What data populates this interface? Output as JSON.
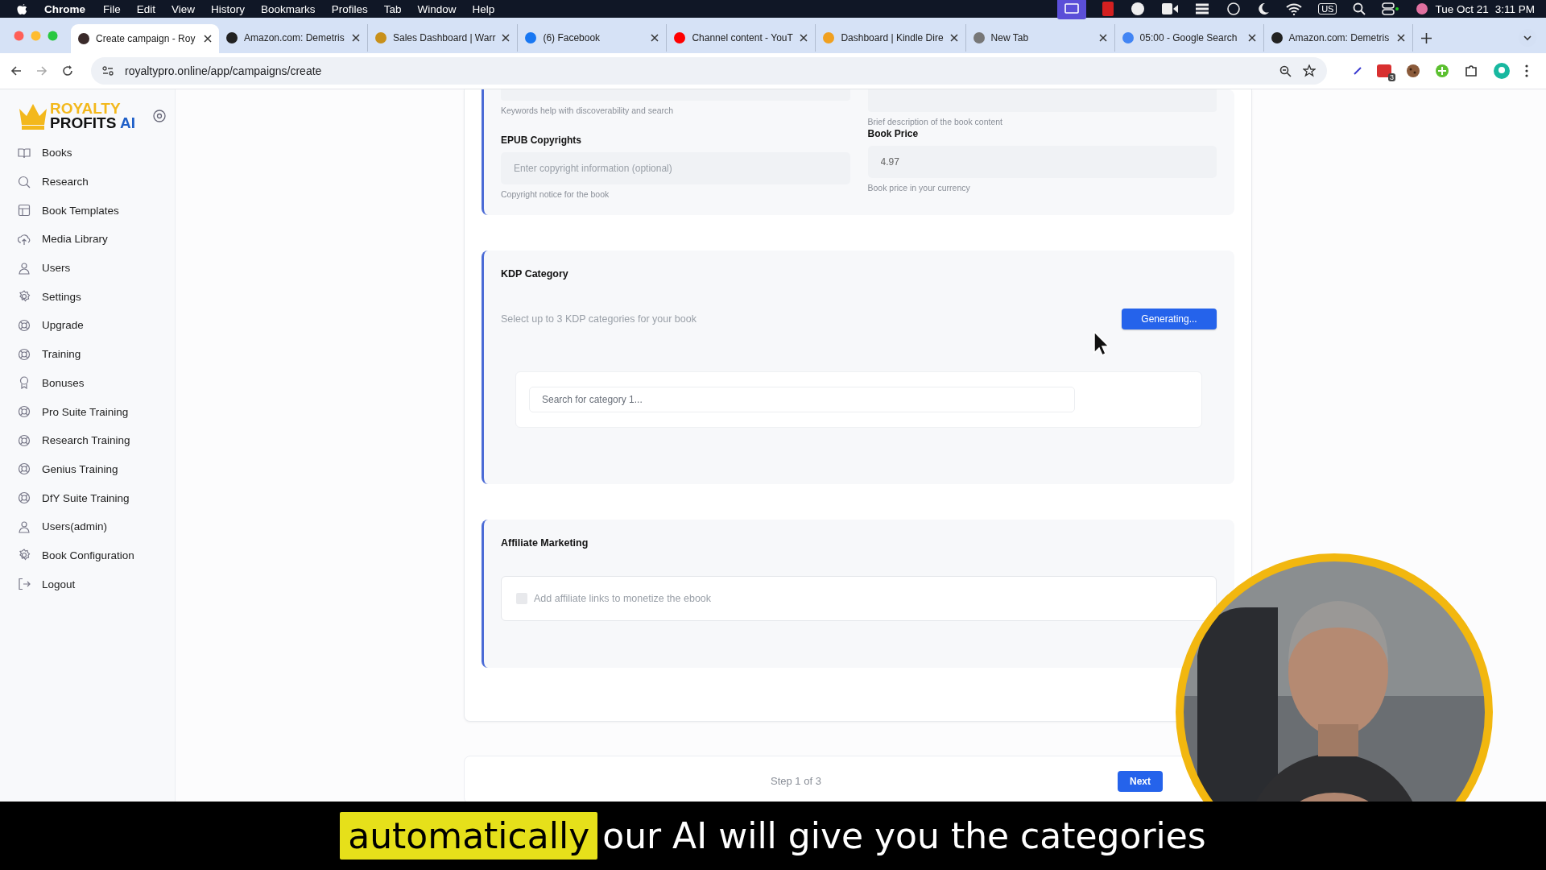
{
  "menu_bar": {
    "app": "Chrome",
    "items": [
      "File",
      "Edit",
      "View",
      "History",
      "Bookmarks",
      "Profiles",
      "Tab",
      "Window",
      "Help"
    ],
    "input_source": "US",
    "date": "Tue Oct 21",
    "time": "3:11 PM"
  },
  "browser": {
    "tabs": [
      {
        "title": "Create campaign - Roy",
        "selected": true
      },
      {
        "title": "Amazon.com: Demetris",
        "selected": false
      },
      {
        "title": "Sales Dashboard | Warr",
        "selected": false
      },
      {
        "title": "(6) Facebook",
        "selected": false
      },
      {
        "title": "Channel content - YouT",
        "selected": false
      },
      {
        "title": "Dashboard | Kindle Dire",
        "selected": false
      },
      {
        "title": "New Tab",
        "selected": false
      },
      {
        "title": "05:00 - Google Search",
        "selected": false
      },
      {
        "title": "Amazon.com: Demetris",
        "selected": false
      }
    ],
    "address": "royaltypro.online/app/campaigns/create",
    "extension_badge": "3"
  },
  "sidebar": {
    "logo": {
      "top": "ROYALTY",
      "bottom": "PROFITS",
      "accent": "AI"
    },
    "items": [
      "Books",
      "Research",
      "Book Templates",
      "Media Library",
      "Users",
      "Settings",
      "Upgrade",
      "Training",
      "Bonuses",
      "Pro Suite Training",
      "Research Training",
      "Genius Training",
      "DfY Suite Training",
      "Users(admin)",
      "Book Configuration",
      "Logout"
    ]
  },
  "form": {
    "top_section": {
      "keywords_hint": "Keywords help with discoverability and search",
      "description_hint": "Brief description of the book content",
      "fields": [
        {
          "label": "EPUB Copyrights",
          "placeholder": "Enter copyright information (optional)",
          "hint": "Copyright notice for the book"
        },
        {
          "label": "Book Price",
          "value": "4.97",
          "hint": "Book price in your currency"
        }
      ]
    },
    "kdp_category": {
      "title": "KDP Category",
      "description": "Select up to 3 KDP categories for your book",
      "button": "Generating...",
      "search_placeholder": "Search for category 1..."
    },
    "affiliate": {
      "title": "Affiliate Marketing",
      "checkbox": {
        "label": "Add affiliate links to monetize the ebook",
        "checked": false
      }
    }
  },
  "footer": {
    "step": "Step 1 of 3",
    "next_button": "Next"
  },
  "subtitle": {
    "highlight": "automatically",
    "text": "our AI will give you the categories"
  }
}
